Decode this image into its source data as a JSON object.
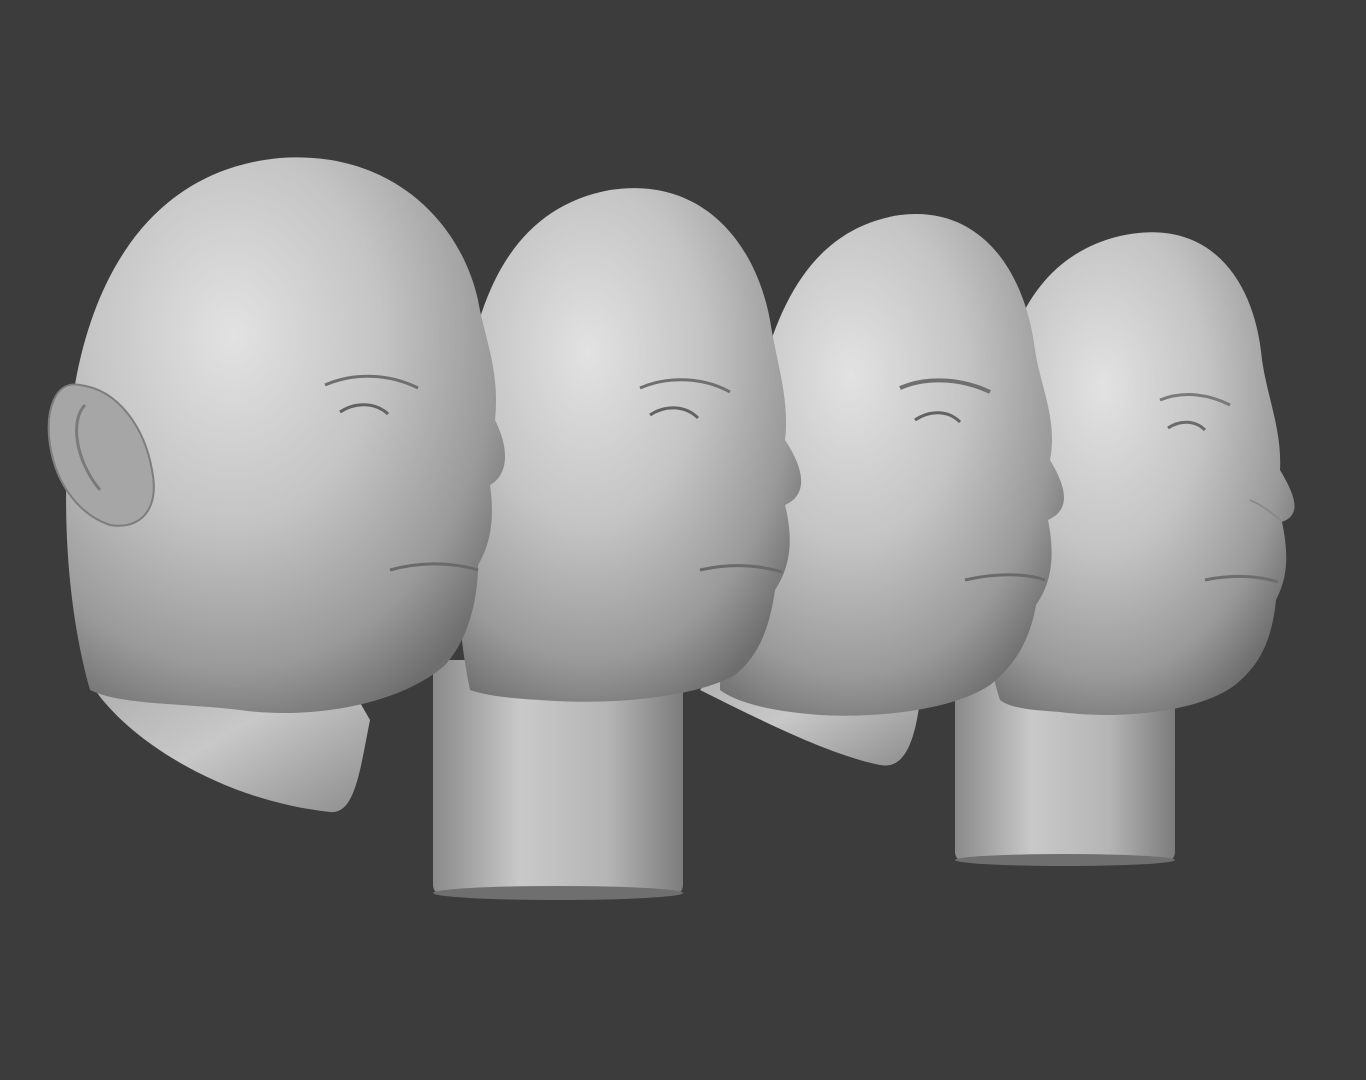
{
  "scene": {
    "background_color": "#3c3c3c",
    "clay_color": "#bdbdbd",
    "models": [
      {
        "name": "head-with-ear-and-neck",
        "has_ear": true,
        "has_pedestal": false,
        "has_brows": false
      },
      {
        "name": "head-on-cylinder-stand",
        "has_ear": false,
        "has_pedestal": true,
        "has_brows": false
      },
      {
        "name": "head-with-brows-neck-cut",
        "has_ear": false,
        "has_pedestal": false,
        "has_brows": true
      },
      {
        "name": "head-with-brows-on-stand",
        "has_ear": false,
        "has_pedestal": true,
        "has_brows": true
      }
    ]
  }
}
